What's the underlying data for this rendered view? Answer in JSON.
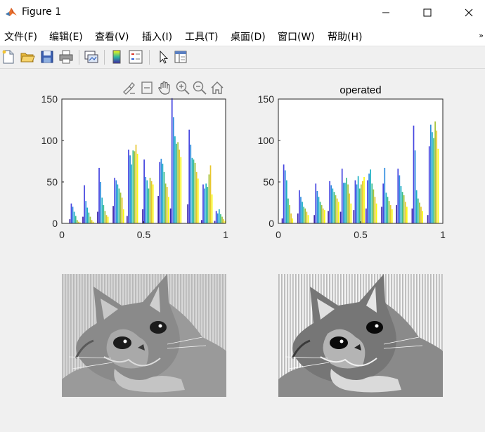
{
  "window": {
    "title": "Figure 1",
    "controls": {
      "minimize": "minimize",
      "maximize": "maximize",
      "close": "close"
    }
  },
  "menu": [
    {
      "label": "文件(F)"
    },
    {
      "label": "编辑(E)"
    },
    {
      "label": "查看(V)"
    },
    {
      "label": "插入(I)"
    },
    {
      "label": "工具(T)"
    },
    {
      "label": "桌面(D)"
    },
    {
      "label": "窗口(W)"
    },
    {
      "label": "帮助(H)"
    }
  ],
  "menu_overflow_icon": "double-chevron-right-icon",
  "toolbar_icons": [
    "new-figure-icon",
    "open-file-icon",
    "save-icon",
    "print-icon",
    "link-axes-icon",
    "colorbar-icon",
    "legend-icon",
    "pointer-icon",
    "property-inspector-icon"
  ],
  "axes_toolbar_icons": [
    "brush-icon",
    "data-tips-icon",
    "pan-hand-icon",
    "zoom-in-icon",
    "zoom-out-icon",
    "home-icon"
  ],
  "colors": {
    "parula_low": "#3e26a8",
    "parula_mid": "#2eb7a0",
    "parula_high": "#f9fb0e",
    "axes_bg": "#ffffff",
    "figure_bg": "#f0f0f0"
  },
  "chart_data": [
    {
      "type": "bar",
      "title": "",
      "xlabel": "",
      "ylabel": "",
      "xlim": [
        0,
        1
      ],
      "ylim": [
        0,
        150
      ],
      "xticks": [
        "0",
        "0.5",
        "1"
      ],
      "yticks": [
        "0",
        "50",
        "100",
        "150"
      ],
      "groups": [
        {
          "x": 0.045,
          "values": [
            5,
            24,
            20,
            14,
            9,
            4,
            2,
            1
          ]
        },
        {
          "x": 0.125,
          "values": [
            8,
            46,
            27,
            19,
            13,
            8,
            4,
            2
          ]
        },
        {
          "x": 0.215,
          "values": [
            14,
            67,
            50,
            31,
            22,
            15,
            10,
            8
          ]
        },
        {
          "x": 0.31,
          "values": [
            21,
            55,
            52,
            47,
            42,
            37,
            31,
            17
          ]
        },
        {
          "x": 0.395,
          "values": [
            9,
            89,
            82,
            71,
            88,
            87,
            95,
            84
          ]
        },
        {
          "x": 0.49,
          "values": [
            17,
            77,
            56,
            52,
            42,
            55,
            51,
            47
          ]
        },
        {
          "x": 0.585,
          "values": [
            33,
            74,
            78,
            72,
            62,
            48,
            44,
            32
          ]
        },
        {
          "x": 0.66,
          "values": [
            18,
            151,
            128,
            105,
            96,
            98,
            89,
            80
          ]
        },
        {
          "x": 0.765,
          "values": [
            23,
            113,
            95,
            79,
            77,
            73,
            62,
            54
          ]
        },
        {
          "x": 0.85,
          "values": [
            4,
            47,
            42,
            48,
            44,
            59,
            70,
            35
          ]
        },
        {
          "x": 0.93,
          "values": [
            3,
            15,
            12,
            17,
            11,
            8,
            5,
            3
          ]
        }
      ]
    },
    {
      "type": "bar",
      "title": "operated",
      "xlabel": "",
      "ylabel": "",
      "xlim": [
        0,
        1
      ],
      "ylim": [
        0,
        150
      ],
      "xticks": [
        "0",
        "0.5",
        "1"
      ],
      "yticks": [
        "0",
        "50",
        "100",
        "150"
      ],
      "groups": [
        {
          "x": 0.02,
          "values": [
            6,
            71,
            64,
            52,
            30,
            22,
            12,
            6
          ]
        },
        {
          "x": 0.115,
          "values": [
            12,
            40,
            32,
            26,
            20,
            18,
            14,
            10
          ]
        },
        {
          "x": 0.215,
          "values": [
            10,
            48,
            39,
            32,
            26,
            22,
            18,
            16
          ]
        },
        {
          "x": 0.3,
          "values": [
            15,
            51,
            46,
            42,
            38,
            34,
            30,
            26
          ]
        },
        {
          "x": 0.375,
          "values": [
            14,
            66,
            49,
            49,
            55,
            47,
            36,
            24
          ]
        },
        {
          "x": 0.455,
          "values": [
            16,
            52,
            47,
            57,
            42,
            47,
            51,
            56
          ]
        },
        {
          "x": 0.53,
          "values": [
            18,
            52,
            60,
            65,
            48,
            41,
            32,
            24
          ]
        },
        {
          "x": 0.625,
          "values": [
            20,
            48,
            67,
            37,
            32,
            27,
            22,
            17
          ]
        },
        {
          "x": 0.715,
          "values": [
            22,
            66,
            58,
            45,
            38,
            34,
            26,
            20
          ]
        },
        {
          "x": 0.81,
          "values": [
            18,
            118,
            88,
            40,
            30,
            25,
            20,
            15
          ]
        },
        {
          "x": 0.905,
          "values": [
            10,
            93,
            119,
            110,
            103,
            123,
            112,
            90
          ]
        }
      ]
    }
  ],
  "images": [
    {
      "icon": "cat-photo-original",
      "label": ""
    },
    {
      "icon": "cat-photo-operated",
      "label": ""
    }
  ]
}
